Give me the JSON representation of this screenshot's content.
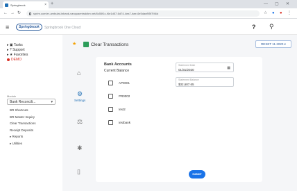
{
  "browser": {
    "tab_title": "Springbrook",
    "url": "sprim.com/er-ambulat-inbank-vanquaentrakitm.net/8c55f1c-f4e1d57-6d74-4ea7-bae-6e5dae8f5f7f46d",
    "new_tab": "+",
    "win_min": "—",
    "win_max": "▢",
    "win_close": "✕"
  },
  "header": {
    "logo": "Springbrook",
    "subtitle": "Springbrook One Cloud",
    "help": "?"
  },
  "sidebar": {
    "nav": [
      "Tasks",
      "Support",
      "Favorites",
      "DEMO"
    ],
    "select_caption": "Module",
    "select_value": "Bank Reconcili...",
    "sub_items": [
      "BR Shortcuts",
      "BR Master Inquiry",
      "Clear Transactions",
      "Receipt Deposits",
      "Reports",
      "Utilities"
    ]
  },
  "main": {
    "title": "Clear Transactions",
    "date_chip": "RESET 11-2020 ▾",
    "rail_label": "Settings",
    "accounts_heading": "Bank Accounts",
    "current_balance_label": "Current Balance",
    "accounts": [
      "AP0001",
      "PR0002",
      "test2",
      "testbank"
    ],
    "statement_date": {
      "label": "Statement Date",
      "value": "01/31/2020"
    },
    "statement_balance": {
      "label": "Statement Balance",
      "value": "$32,687.65"
    },
    "submit_label": "SUBMIT"
  },
  "colors": {
    "accent": "#1a73e8",
    "brand": "#2e5e9e",
    "demo": "#d93025",
    "star": "#f4a000"
  }
}
